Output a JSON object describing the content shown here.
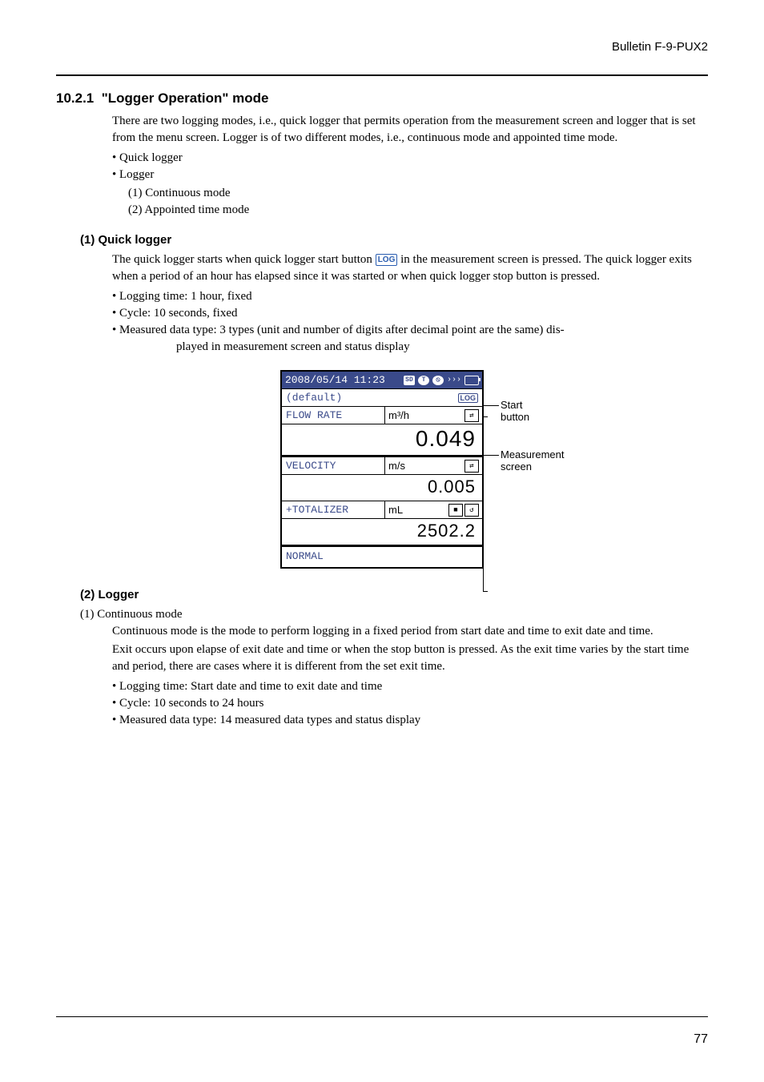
{
  "header": {
    "bulletin": "Bulletin F-9-PUX2"
  },
  "section": {
    "number": "10.2.1",
    "title": "\"Logger Operation\" mode",
    "intro": "There are two logging modes, i.e., quick logger that permits operation from the measurement screen and logger that is set from the menu screen.  Logger is of two different modes, i.e., continuous mode and appointed time mode.",
    "bullets": [
      "Quick logger",
      "Logger"
    ],
    "logger_sub": [
      "(1)   Continuous mode",
      "(2)   Appointed time mode"
    ]
  },
  "quick": {
    "heading": "(1)  Quick logger",
    "p1a": "The quick logger starts when quick logger start button ",
    "log_label": "LOG",
    "p1b": " in the measurement screen is pressed. The quick logger exits when a period of an hour has elapsed since it was started or when quick logger stop button is pressed.",
    "bullets": [
      "Logging time: 1 hour, fixed",
      "Cycle: 10 seconds, fixed"
    ],
    "bullet3a": "Measured data type: 3 types (unit and number of digits after decimal point are the same) dis-",
    "bullet3b": "played in measurement screen and status display"
  },
  "device": {
    "datetime": "2008/05/14 11:23",
    "sd": "SD",
    "t_icon": "T",
    "default_label": "(default)",
    "log_btn": "LOG",
    "rows": [
      {
        "label": "FLOW RATE",
        "unit": "m³/h",
        "value": "0.049",
        "icons": "arrow"
      },
      {
        "label": "VELOCITY",
        "unit": "m/s",
        "value": "0.005",
        "icons": "arrow"
      },
      {
        "label": "+TOTALIZER",
        "unit": "mL",
        "value": "2502.2",
        "icons": "stopreset"
      }
    ],
    "status": "NORMAL"
  },
  "callouts": {
    "start": "Start button",
    "measurement": "Measurement screen"
  },
  "logger2": {
    "heading": "(2)  Logger",
    "sub1": "(1)   Continuous mode",
    "p1": "Continuous mode is the mode to perform logging in a fixed period from start date and time to exit date and time.",
    "p2": "Exit occurs upon elapse of exit date and time or when the stop button is pressed.  As the exit time varies by the start time and period, there are cases where it is different from the set exit time.",
    "bullets": [
      "Logging time: Start date and time to exit date and time",
      "Cycle: 10 seconds to 24 hours",
      "Measured data type: 14 measured data types and status display"
    ]
  },
  "page_number": "77"
}
